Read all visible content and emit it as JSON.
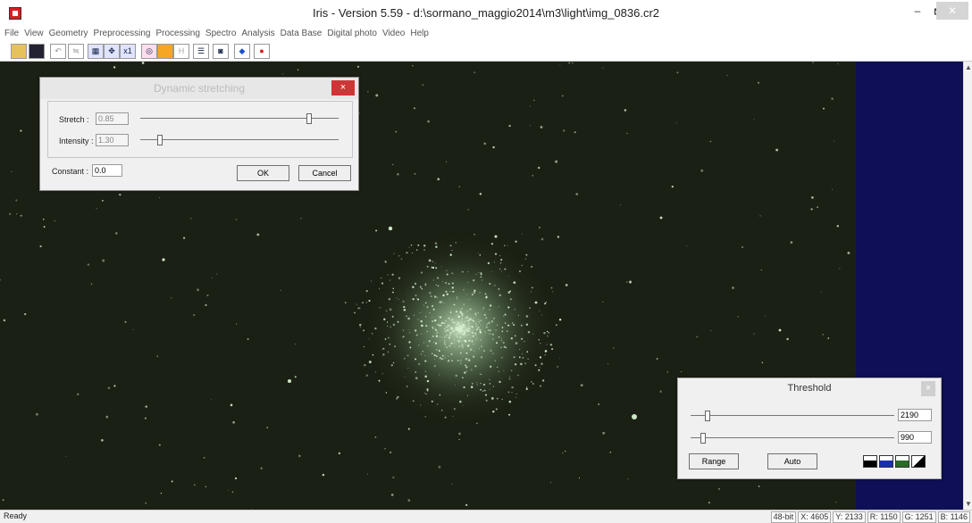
{
  "window": {
    "title": "Iris - Version 5.59 - d:\\sormano_maggio2014\\m3\\light\\img_0836.cr2",
    "minimize": "–",
    "restore": "🗗",
    "close": "✕"
  },
  "menu": [
    "File",
    "View",
    "Geometry",
    "Preprocessing",
    "Processing",
    "Spectro",
    "Analysis",
    "Data Base",
    "Digital photo",
    "Video",
    "Help"
  ],
  "toolbar_icons": [
    "open-icon",
    "save-icon",
    "undo-icon",
    "settings-icon",
    "zoom-icon",
    "move-icon",
    "x1-icon",
    "color-icon",
    "histogram-icon",
    "h-icon",
    "list-icon",
    "camera-icon",
    "star-blue-icon",
    "star-red-icon"
  ],
  "toolbar_glyphs": {
    "x1": "x1",
    "h": "H"
  },
  "stretch_dialog": {
    "title": "Dynamic stretching",
    "stretch_label": "Stretch :",
    "stretch_value": "0.85",
    "stretch_level": 0.85,
    "intensity_label": "Intensity :",
    "intensity_value": "1.30",
    "intensity_level": 0.1,
    "constant_label": "Constant :",
    "constant_value": "0.0",
    "ok": "OK",
    "cancel": "Cancel",
    "close": "×"
  },
  "threshold_dialog": {
    "title": "Threshold",
    "high_value": "2190",
    "low_value": "990",
    "range": "Range",
    "auto": "Auto",
    "close": "×",
    "swatches": [
      "#000000",
      "#1a2fb0",
      "#2a6a2a",
      "#000000"
    ]
  },
  "status": {
    "ready": "Ready",
    "depth": "48-bit",
    "x": "X: 4605",
    "y": "Y: 2133",
    "r": "R: 1150",
    "g": "G: 1251",
    "b": "B: 1146"
  },
  "colors": {
    "sky": "#1b2014",
    "border_blue": "#0f0f58",
    "star": "#d8f0d0"
  }
}
